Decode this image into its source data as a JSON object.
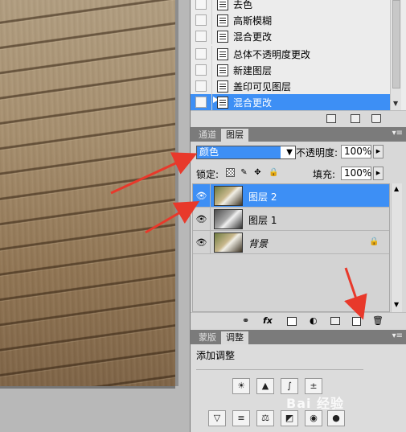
{
  "history": {
    "items": [
      {
        "label": "去色"
      },
      {
        "label": "高斯模糊"
      },
      {
        "label": "混合更改"
      },
      {
        "label": "总体不透明度更改"
      },
      {
        "label": "新建图层"
      },
      {
        "label": "盖印可见图层"
      },
      {
        "label": "混合更改",
        "selected": true
      }
    ]
  },
  "layers_panel": {
    "tabs": [
      {
        "label": "通道"
      },
      {
        "label": "图层",
        "active": true
      }
    ],
    "blend_mode": "颜色",
    "opacity_label": "不透明度:",
    "opacity_value": "100%",
    "lock_label": "锁定:",
    "fill_label": "填充:",
    "fill_value": "100%",
    "layers": [
      {
        "name": "图层 2",
        "selected": true,
        "visible": true
      },
      {
        "name": "图层 1",
        "selected": false,
        "visible": true
      },
      {
        "name": "背景",
        "selected": false,
        "visible": true,
        "locked": true
      }
    ]
  },
  "adjustments_panel": {
    "tabs": [
      {
        "label": "蒙版"
      },
      {
        "label": "调整",
        "active": true
      }
    ],
    "title": "添加调整"
  },
  "watermark": "Bai 经验",
  "colors": {
    "selection": "#3d8ff5",
    "arrow": "#e8392b"
  }
}
